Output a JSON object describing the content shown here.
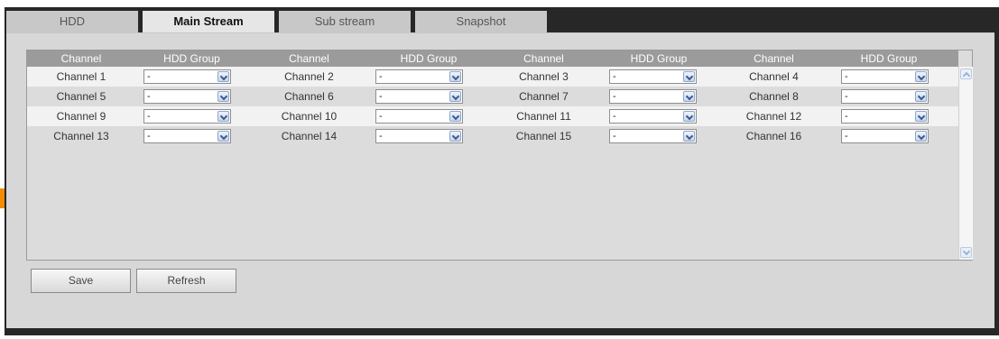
{
  "tabs": [
    {
      "label": "HDD",
      "active": false
    },
    {
      "label": "Main Stream",
      "active": true
    },
    {
      "label": "Sub stream",
      "active": false
    },
    {
      "label": "Snapshot",
      "active": false
    }
  ],
  "grid": {
    "headers": [
      "Channel",
      "HDD Group",
      "Channel",
      "HDD Group",
      "Channel",
      "HDD Group",
      "Channel",
      "HDD Group"
    ],
    "rows": [
      [
        {
          "channel": "Channel 1",
          "group": "-"
        },
        {
          "channel": "Channel 2",
          "group": "-"
        },
        {
          "channel": "Channel 3",
          "group": "-"
        },
        {
          "channel": "Channel 4",
          "group": "-"
        }
      ],
      [
        {
          "channel": "Channel 5",
          "group": "-"
        },
        {
          "channel": "Channel 6",
          "group": "-"
        },
        {
          "channel": "Channel 7",
          "group": "-"
        },
        {
          "channel": "Channel 8",
          "group": "-"
        }
      ],
      [
        {
          "channel": "Channel 9",
          "group": "-"
        },
        {
          "channel": "Channel 10",
          "group": "-"
        },
        {
          "channel": "Channel 11",
          "group": "-"
        },
        {
          "channel": "Channel 12",
          "group": "-"
        }
      ],
      [
        {
          "channel": "Channel 13",
          "group": "-"
        },
        {
          "channel": "Channel 14",
          "group": "-"
        },
        {
          "channel": "Channel 15",
          "group": "-"
        },
        {
          "channel": "Channel 16",
          "group": "-"
        }
      ]
    ]
  },
  "buttons": {
    "save": "Save",
    "refresh": "Refresh"
  },
  "colors": {
    "frame": "#272727",
    "panel": "#d7d7d7",
    "header": "#9b9b9b",
    "accent": "#f28c00"
  },
  "icons": {
    "dropdown": "chevron-down-icon",
    "scroll_up": "scroll-up-icon",
    "scroll_down": "scroll-down-icon"
  }
}
